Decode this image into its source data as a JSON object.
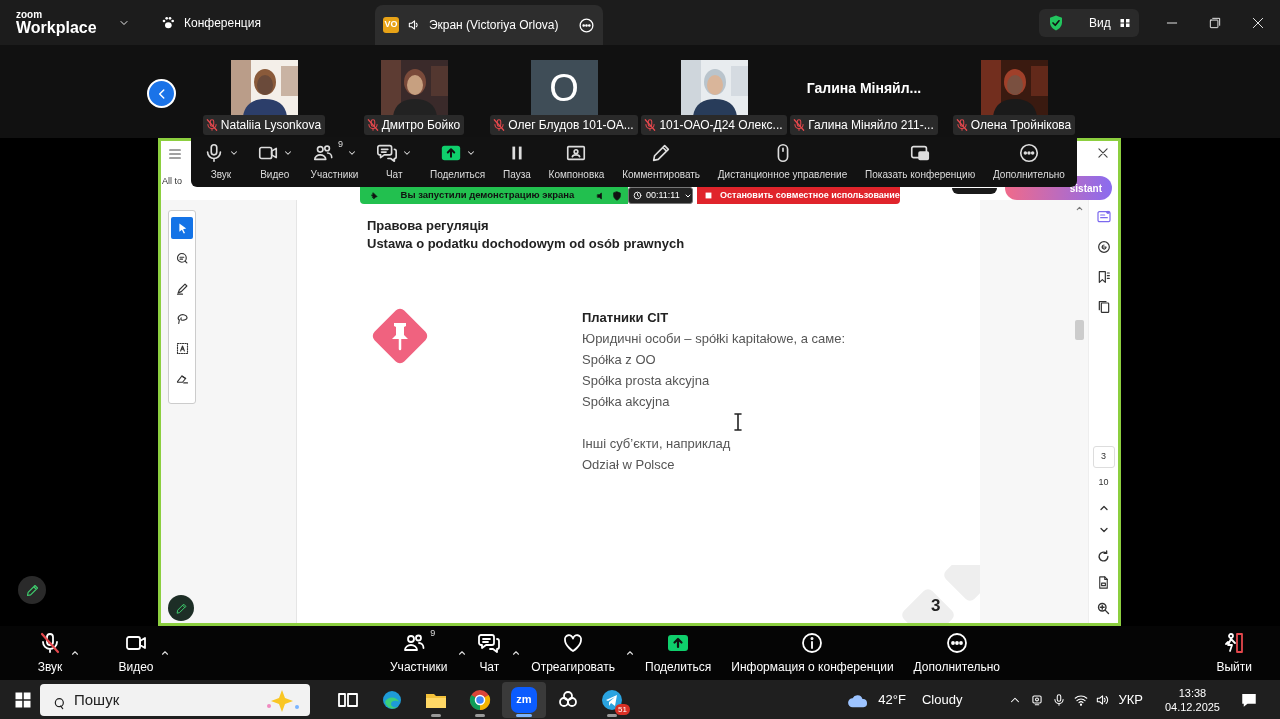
{
  "top_bar": {
    "logo_top": "zoom",
    "logo_bottom": "Workplace",
    "meeting_label": "Конференция",
    "tab": {
      "badge": "VO",
      "title": "Экран (Victoriya Orlova)",
      "selected": true
    },
    "view_button": "Вид"
  },
  "participants": [
    {
      "kind": "video",
      "name": "Nataliia Lysonkova",
      "muted": true
    },
    {
      "kind": "video",
      "name": "Дмитро Бойко",
      "muted": true
    },
    {
      "kind": "avatar",
      "initial": "O",
      "name": "Олег Блудов 101-ОА...",
      "muted": true
    },
    {
      "kind": "video",
      "name": "101-ОАО-Д24 Олекс...",
      "muted": true
    },
    {
      "kind": "no_video",
      "display_name": "Галина Міняйл...",
      "name": "Галина Міняйло 211-...",
      "muted": true
    },
    {
      "kind": "video",
      "name": "Олена Тройнікова",
      "muted": true
    }
  ],
  "share_toolbar": [
    {
      "label": "Звук",
      "caret": true
    },
    {
      "label": "Видео",
      "caret": true
    },
    {
      "label": "Участники",
      "count": "9",
      "caret": true
    },
    {
      "label": "Чат",
      "caret": true
    },
    {
      "label": "Поделиться",
      "caret": true
    },
    {
      "label": "Пауза",
      "caret": false
    },
    {
      "label": "Компоновка",
      "caret": false
    },
    {
      "label": "Комментировать",
      "caret": false
    },
    {
      "label": "Дистанционное управление",
      "caret": false
    },
    {
      "label": "Показать конференцию",
      "caret": false
    },
    {
      "label": "Дополнительно",
      "caret": false
    }
  ],
  "share_banner": {
    "message": "Вы запустили демонстрацию экрана",
    "timer": "00:11:11",
    "stop_label": "Остановить совместное использование"
  },
  "viewer": {
    "header_text": "All to",
    "assistant_button": "sistant",
    "tools": [
      {
        "selected": true
      },
      {
        "selected": false
      },
      {
        "selected": false
      },
      {
        "selected": false
      },
      {
        "selected": false
      },
      {
        "selected": false
      }
    ],
    "document": {
      "heading": [
        "Правова регуляція",
        "Ustawa o podatku dochodowym od osób prawnych"
      ],
      "list_title": "Платники CIT",
      "list_lines": [
        "Юридичні особи – spółki kapitałowe, a саме:",
        "Spółka z OO",
        "Spółka prosta akcyjna",
        "Spółka akcyjna"
      ],
      "other_lines": [
        "Інші суб’єкти, наприклад",
        "Odział w Polsce"
      ],
      "page_number": "3"
    },
    "page_box": "3",
    "page_total": "10"
  },
  "bottom_toolbar": {
    "left": [
      {
        "label": "Звук",
        "muted": true,
        "caret": true
      },
      {
        "label": "Видео",
        "muted": false,
        "caret": true
      }
    ],
    "center": [
      {
        "label": "Участники",
        "count": "9",
        "caret": true
      },
      {
        "label": "Чат",
        "caret": true
      },
      {
        "label": "Отреагировать",
        "caret": true
      },
      {
        "label": "Поделиться",
        "caret": false
      },
      {
        "label": "Информация о конференции",
        "caret": false
      },
      {
        "label": "Дополнительно",
        "caret": false
      }
    ],
    "leave_label": "Выйти"
  },
  "taskbar": {
    "search_placeholder": "Пошук",
    "apps": [
      {
        "kind": "task_view",
        "running": false,
        "selected": false
      },
      {
        "kind": "edge",
        "running": false,
        "selected": false
      },
      {
        "kind": "explorer",
        "running": true,
        "selected": false
      },
      {
        "kind": "chrome",
        "running": true,
        "selected": false
      },
      {
        "kind": "zoom",
        "label": "zm",
        "running": true,
        "selected": true
      },
      {
        "kind": "assistant",
        "running": false,
        "selected": false
      },
      {
        "kind": "telegram",
        "badge": "51",
        "running": true,
        "selected": false
      }
    ],
    "temperature": "42°F",
    "weather": "Cloudy",
    "language": "УКР",
    "time": "13:38",
    "date": "04.12.2025"
  }
}
